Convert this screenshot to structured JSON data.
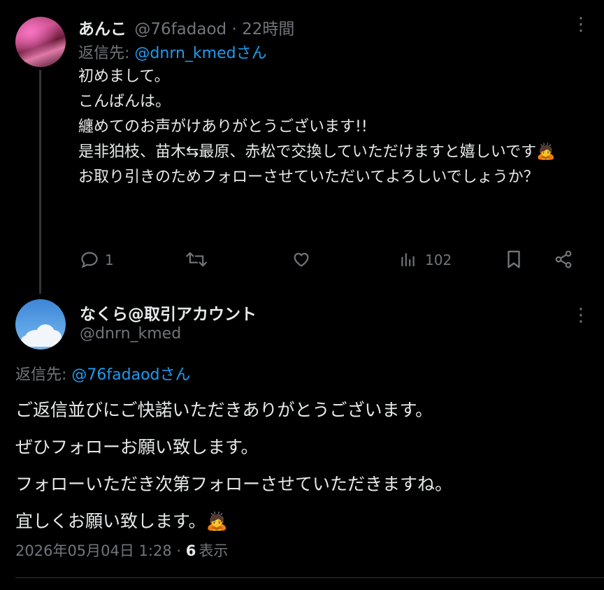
{
  "tweet1": {
    "name": "あんこ",
    "meta": "@76fadaod · 22時間",
    "reply_prefix": "返信先: ",
    "reply_to": "@dnrn_kmedさん",
    "body": "初めまして。\nこんばんは。\n纏めてのお声がけありがとうございます!!\n是非狛枝、苗木⇆最原、赤松で交換していただけますと嬉しいです🙇\nお取り引きのためフォローさせていただいてよろしいでしょうか？",
    "replies": "1",
    "views": "102",
    "icons": [
      "reply-icon",
      "retweet-icon",
      "like-icon",
      "views-icon",
      "bookmark-icon",
      "share-icon",
      "more-icon"
    ]
  },
  "tweet2": {
    "name": "なくら@取引アカウント",
    "handle": "@dnrn_kmed",
    "reply_prefix": "返信先: ",
    "reply_to": "@76fadaodさん",
    "body": "ご返信並びにご快諾いただきありがとうございます。\nぜひフォローお願い致します。\nフォローいただき次第フォローさせていただきますね。\n宜しくお願い致します。🙇",
    "timestamp": "2026年05月04日 1:28 · ",
    "views_count": "6",
    "views_label": "表示"
  },
  "colors": {
    "accent": "#1d9bf0",
    "muted": "#71767b",
    "text": "#e7e9ea",
    "background": "#000000"
  }
}
